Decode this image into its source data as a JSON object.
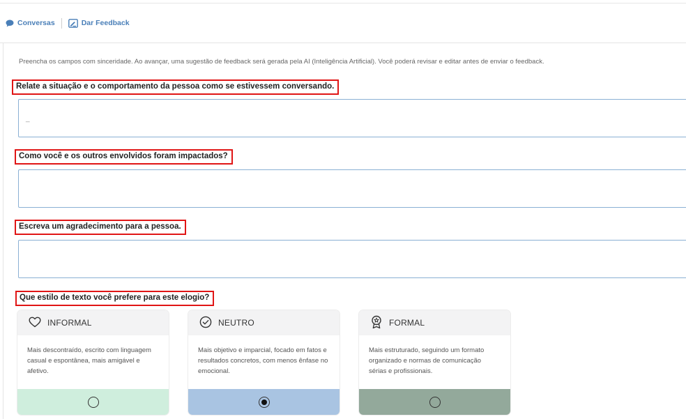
{
  "breadcrumb": {
    "conversas": "Conversas",
    "feedback": "Dar Feedback"
  },
  "intro": "Preencha os campos com sinceridade. Ao avançar, uma sugestão de feedback será gerada pela AI (Inteligência Artificial). Você poderá revisar e editar antes de enviar o feedback.",
  "questions": [
    {
      "label": "Relate a situação e o comportamento da pessoa como se estivessem conversando.",
      "value": ""
    },
    {
      "label": "Como você e os outros envolvidos foram impactados?",
      "value": ""
    },
    {
      "label": "Escreva um agradecimento para a pessoa.",
      "value": ""
    }
  ],
  "style_question": "Que estilo de texto você prefere para este elogio?",
  "styles": [
    {
      "title": "INFORMAL",
      "icon": "heart-icon",
      "description": "Mais descontraído, escrito com linguagem casual e espontânea, mais amigável e afetivo.",
      "color": "#cfeedd",
      "selected": false
    },
    {
      "title": "NEUTRO",
      "icon": "check-circle-icon",
      "description": "Mais objetivo e imparcial, focado em fatos e resultados concretos, com menos ênfase no emocional.",
      "color": "#a9c4e2",
      "selected": true
    },
    {
      "title": "FORMAL",
      "icon": "award-icon",
      "description": "Mais estruturado, seguindo um formato organizado e normas de comunicação sérias e profissionais.",
      "color": "#93a99b",
      "selected": false
    }
  ],
  "colors": {
    "accent": "#4a7fb8",
    "highlight_border": "#e01515",
    "input_border": "#8ab0d4"
  }
}
